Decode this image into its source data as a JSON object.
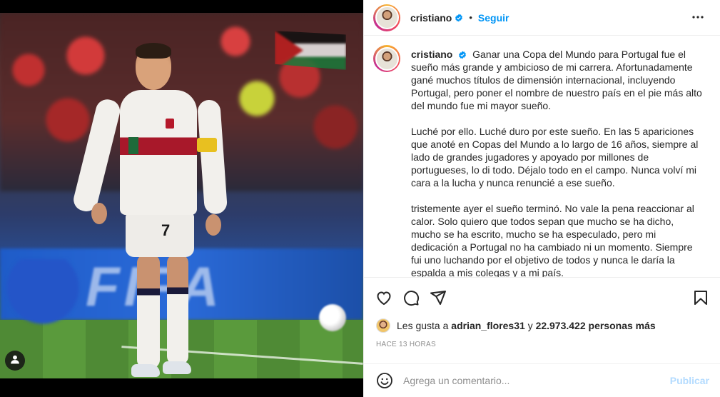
{
  "post": {
    "username": "cristiano",
    "separator": "•",
    "follow_label": "Seguir",
    "caption_paragraphs": [
      "Ganar una Copa del Mundo para Portugal fue el sueño más grande y ambicioso de mi carrera. Afortunadamente gané muchos títulos de dimensión internacional, incluyendo Portugal, pero poner el nombre de nuestro país en el pie más alto del mundo fue mi mayor sueño.",
      "Luché por ello. Luché duro por este sueño. En las 5 apariciones que anoté en Copas del Mundo a lo largo de 16 años, siempre al lado de grandes jugadores y apoyado por millones de portugueses, lo di todo. Déjalo todo en el campo. Nunca volví mi cara a la lucha y nunca renuncié a ese sueño.",
      "tristemente ayer el sueño terminó. No vale la pena reaccionar al calor. Solo quiero que todos sepan que mucho se ha dicho, mucho se ha escrito, mucho se ha especulado, pero mi dedicación a Portugal no ha cambiado ni un momento. Siempre fui uno luchando por el objetivo de todos y nunca le daría la espalda a mis colegas y a mi país."
    ]
  },
  "likes": {
    "prefix": "Les gusta a",
    "user": "adrian_flores31",
    "connector": "y",
    "count_text": "22.973.422 personas más"
  },
  "timestamp": "HACE 13 HORAS",
  "comment": {
    "placeholder": "Agrega un comentario...",
    "publish_label": "Publicar"
  },
  "media": {
    "player_number": "7",
    "board_text": "FIFA"
  },
  "icons": [
    "verified-badge-icon",
    "more-options-icon",
    "heart-icon",
    "comment-icon",
    "share-icon",
    "bookmark-icon",
    "emoji-icon",
    "user-tag-icon"
  ],
  "colors": {
    "accent": "#0095f6",
    "publish_disabled": "#b3dbff",
    "muted": "#8e8e8e",
    "text": "#262626"
  }
}
